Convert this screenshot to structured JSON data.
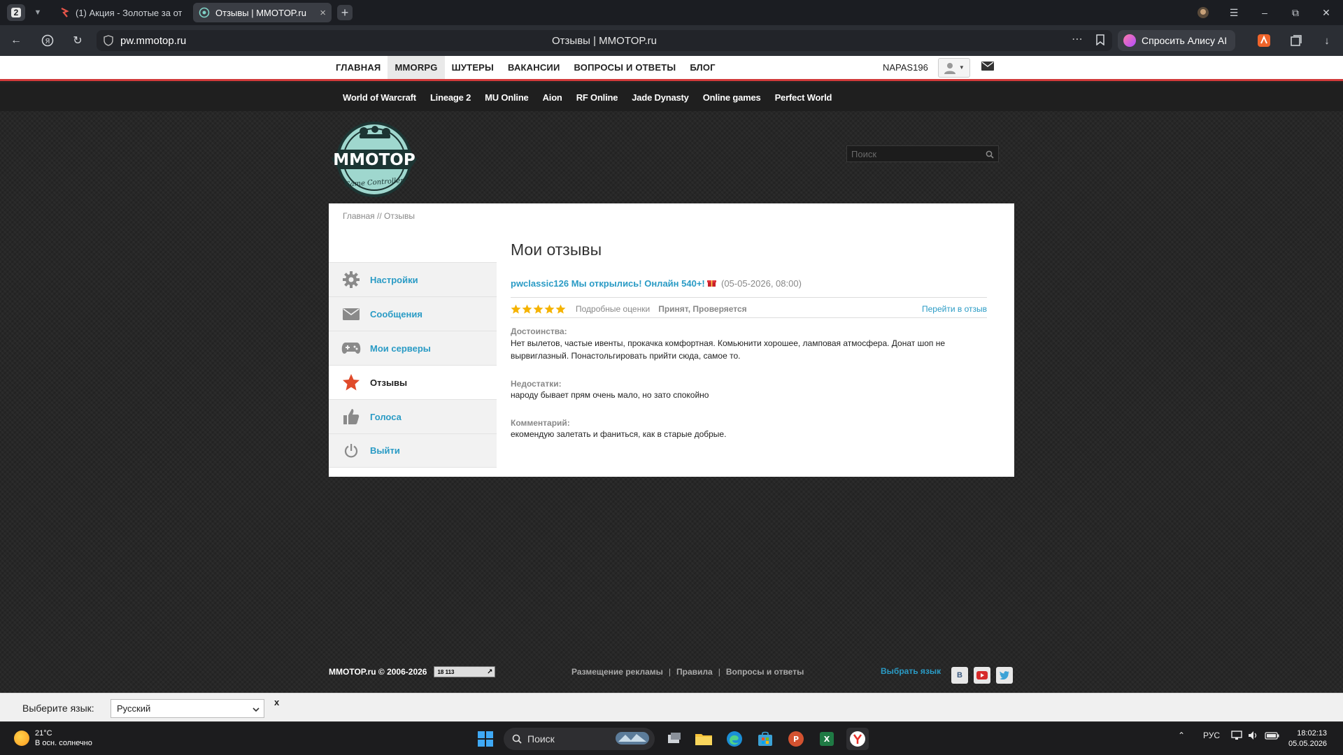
{
  "browser": {
    "tab_count": "2",
    "tabs": [
      {
        "title": "(1) Акция - Золотые за от"
      },
      {
        "title": "Отзывы | MMOTOP.ru"
      }
    ],
    "url": "pw.mmotop.ru",
    "page_title": "Отзывы | MMOTOP.ru",
    "alisa_label": "Спросить Алису AI"
  },
  "site_nav": {
    "items": [
      "ГЛАВНАЯ",
      "MMORPG",
      "ШУТЕРЫ",
      "ВАКАНСИИ",
      "ВОПРОСЫ И ОТВЕТЫ",
      "БЛОГ"
    ],
    "active": "MMORPG",
    "username": "NAPAS196"
  },
  "game_nav": {
    "items": [
      "World of Warcraft",
      "Lineage 2",
      "MU Online",
      "Aion",
      "RF Online",
      "Jade Dynasty",
      "Online games",
      "Perfect World"
    ]
  },
  "logo": {
    "title": "MMOTOP",
    "subtitle": "Game Controller"
  },
  "search": {
    "placeholder": "Поиск"
  },
  "breadcrumb": {
    "home": "Главная",
    "sep": " // ",
    "current": "Отзывы"
  },
  "sidebar": {
    "items": [
      {
        "label": "Настройки",
        "icon": "gear-icon"
      },
      {
        "label": "Сообщения",
        "icon": "envelope-icon"
      },
      {
        "label": "Мои серверы",
        "icon": "gamepad-icon"
      },
      {
        "label": "Отзывы",
        "icon": "star-icon",
        "active": true
      },
      {
        "label": "Голоса",
        "icon": "thumbs-up-icon"
      },
      {
        "label": "Выйти",
        "icon": "power-icon"
      }
    ]
  },
  "main": {
    "title": "Мои отзывы",
    "review": {
      "server": "pwclassic126 Мы открылись! Онлайн 540+!",
      "date": "(05-05-2026, 08:00)",
      "rating": 5,
      "detailed_ratings": "Подробные оценки",
      "status": "Принят, Проверяется",
      "goto_label": "Перейти в отзыв",
      "pros_label": "Достоинства:",
      "pros_text": "Нет вылетов, частые ивенты, прокачка комфортная. Комьюнити хорошее, ламповая атмосфера. Донат шоп не вырвиглазный. Понастольгировать прийти сюда, самое то.",
      "cons_label": "Недостатки:",
      "cons_text": "народу бывает прям очень мало, но зато спокойно",
      "comment_label": "Комментарий:",
      "comment_text": "екомендую залетать и фаниться, как в старые добрые."
    }
  },
  "footer": {
    "copyright": "MMOTOP.ru © 2006-2026",
    "counter": "18 113",
    "links": [
      "Размещение рекламы",
      "Правила",
      "Вопросы и ответы"
    ],
    "choose_lang": "Выбрать язык",
    "social": [
      "В",
      "YT",
      "Tw"
    ]
  },
  "langbar": {
    "label": "Выберите язык:",
    "selected": "Русский",
    "close": "x"
  },
  "taskbar": {
    "weather_temp": "21°C",
    "weather_desc": "В осн. солнечно",
    "search_placeholder": "Поиск",
    "lang": "РУС",
    "time": "18:02:13",
    "date": "05.05.2026"
  },
  "colors": {
    "accent": "#2a9bc5",
    "nav_red": "#d23a3a",
    "star": "#f5b301"
  }
}
